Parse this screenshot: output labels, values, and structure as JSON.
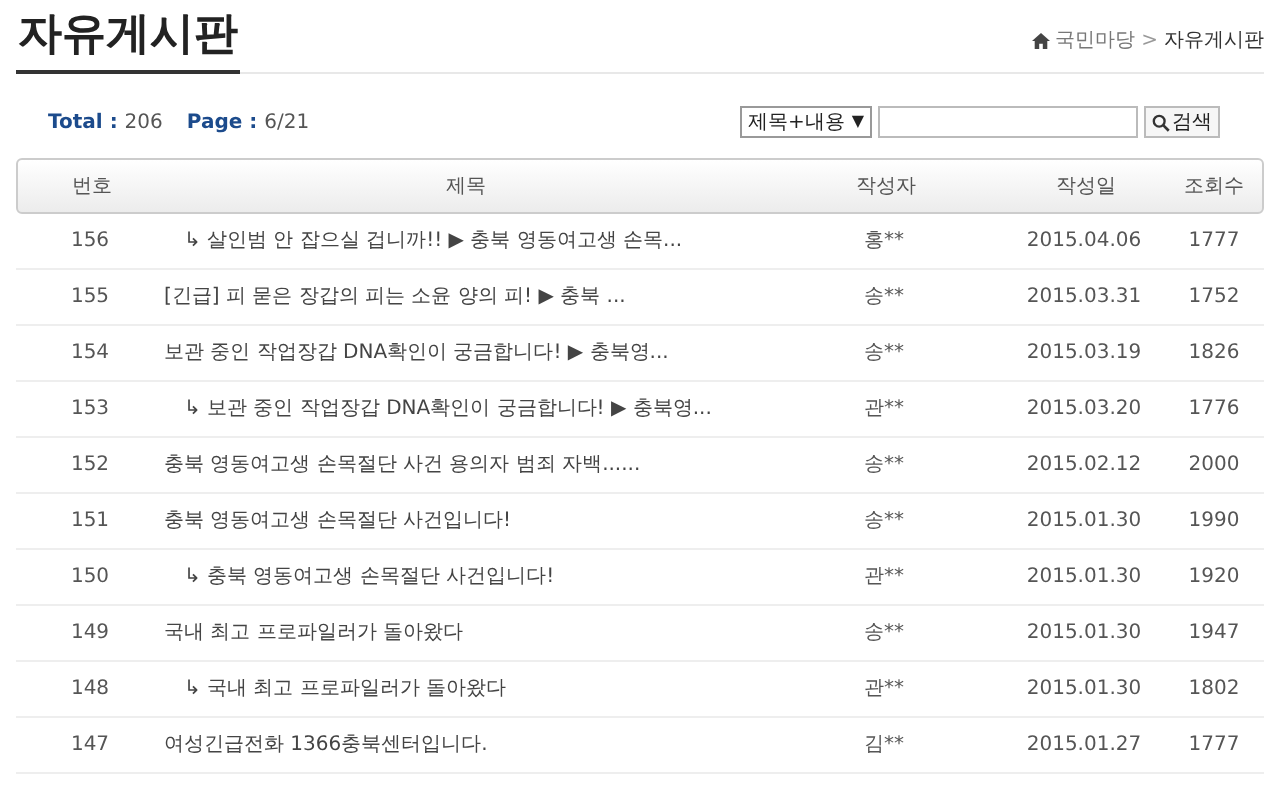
{
  "page_title": "자유게시판",
  "breadcrumb": [
    "국민마당",
    "자유게시판"
  ],
  "breadcrumb_separator": ">",
  "summary": {
    "separator": ":",
    "total_label": "Total",
    "total": "206",
    "page_label": "Page",
    "page": "6/21"
  },
  "search": {
    "scope": "제목+내용",
    "scope_arrow": "▼",
    "button": "검색"
  },
  "table": {
    "columns": [
      "번호",
      "제목",
      "작성자",
      "작성일",
      "조회수"
    ],
    "rows": [
      {
        "kind": "reply",
        "number": "156",
        "title": "↳ 살인범 안 잡으실 겁니까!! ▶ 충북 영동여고생 손목...",
        "author": "홍**",
        "date": "2015.04.06",
        "views": "1777"
      },
      {
        "kind": "post",
        "number": "155",
        "title": "[긴급] 피 묻은 장갑의 피는 소윤 양의 피! ▶ 충북 ...",
        "author": "송**",
        "date": "2015.03.31",
        "views": "1752"
      },
      {
        "kind": "post",
        "number": "154",
        "title": "보관 중인 작업장갑 DNA확인이 궁금합니다! ▶ 충북영...",
        "author": "송**",
        "date": "2015.03.19",
        "views": "1826"
      },
      {
        "kind": "reply",
        "number": "153",
        "title": "↳ 보관 중인 작업장갑 DNA확인이 궁금합니다! ▶ 충북영...",
        "author": "관**",
        "date": "2015.03.20",
        "views": "1776"
      },
      {
        "kind": "post",
        "number": "152",
        "title": "충북 영동여고생 손목절단 사건 용의자 범죄 자백......",
        "author": "송**",
        "date": "2015.02.12",
        "views": "2000"
      },
      {
        "kind": "post",
        "number": "151",
        "title": "충북 영동여고생 손목절단 사건입니다!",
        "author": "송**",
        "date": "2015.01.30",
        "views": "1990"
      },
      {
        "kind": "reply",
        "number": "150",
        "title": "↳ 충북 영동여고생 손목절단 사건입니다!",
        "author": "관**",
        "date": "2015.01.30",
        "views": "1920"
      },
      {
        "kind": "post",
        "number": "149",
        "title": "국내 최고 프로파일러가 돌아왔다",
        "author": "송**",
        "date": "2015.01.30",
        "views": "1947"
      },
      {
        "kind": "reply",
        "number": "148",
        "title": "↳ 국내 최고 프로파일러가 돌아왔다",
        "author": "관**",
        "date": "2015.01.30",
        "views": "1802"
      },
      {
        "kind": "post",
        "number": "147",
        "title": "여성긴급전화 1366충북센터입니다.",
        "author": "김**",
        "date": "2015.01.27",
        "views": "1777"
      }
    ]
  }
}
